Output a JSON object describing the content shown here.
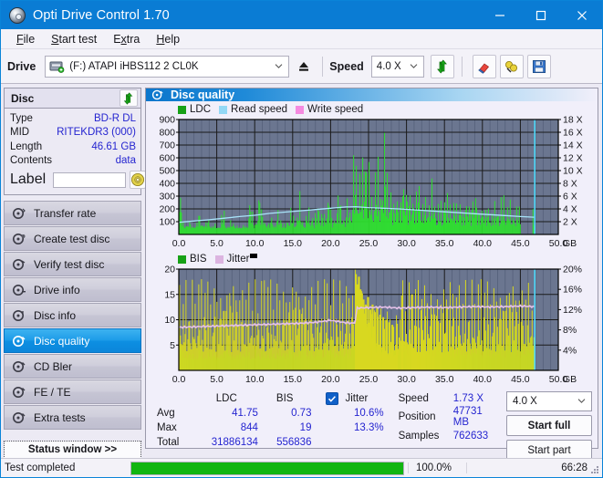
{
  "window": {
    "title": "Opti Drive Control 1.70",
    "icon": "disc-icon",
    "minimize": "minimize-icon",
    "maximize": "maximize-icon",
    "close": "close-icon"
  },
  "menu": [
    {
      "label": "File",
      "accel": "F"
    },
    {
      "label": "Start test",
      "accel": "S"
    },
    {
      "label": "Extra",
      "accel": "x"
    },
    {
      "label": "Help",
      "accel": "H"
    }
  ],
  "toolbar": {
    "drive_label": "Drive",
    "drive_value": "(F:)  ATAPI iHBS112  2 CL0K",
    "eject_icon": "eject-icon",
    "speed_label": "Speed",
    "speed_value": "4.0 X",
    "refresh_icon": "refresh-icon",
    "eraser_icon": "eraser-icon",
    "bulb_icon": "bulb-icon",
    "save_icon": "save-icon"
  },
  "disc_panel": {
    "title": "Disc",
    "refresh_icon": "refresh-icon",
    "rows": [
      {
        "key": "Type",
        "value": "BD-R DL"
      },
      {
        "key": "MID",
        "value": "RITEKDR3 (000)"
      },
      {
        "key": "Length",
        "value": "46.61 GB"
      },
      {
        "key": "Contents",
        "value": "data"
      }
    ],
    "label_key": "Label",
    "label_value": "",
    "label_placeholder": "",
    "cd_icon": "cd-icon"
  },
  "nav": {
    "items": [
      {
        "label": "Transfer rate",
        "icon": "disc-test-icon",
        "active": false
      },
      {
        "label": "Create test disc",
        "icon": "disc-test-icon",
        "active": false
      },
      {
        "label": "Verify test disc",
        "icon": "disc-test-icon",
        "active": false
      },
      {
        "label": "Drive info",
        "icon": "disc-test-icon",
        "active": false
      },
      {
        "label": "Disc info",
        "icon": "disc-test-icon",
        "active": false
      },
      {
        "label": "Disc quality",
        "icon": "disc-test-icon",
        "active": true
      },
      {
        "label": "CD Bler",
        "icon": "disc-test-icon",
        "active": false
      },
      {
        "label": "FE / TE",
        "icon": "disc-test-icon",
        "active": false
      },
      {
        "label": "Extra tests",
        "icon": "disc-test-icon",
        "active": false
      }
    ],
    "status_window": "Status window >>"
  },
  "content": {
    "header_title": "Disc quality",
    "header_icon": "disc-quality-icon"
  },
  "stats": {
    "headers": {
      "ldc": "LDC",
      "bis": "BIS"
    },
    "rows": [
      {
        "key": "Avg",
        "ldc": "41.75",
        "bis": "0.73"
      },
      {
        "key": "Max",
        "ldc": "844",
        "bis": "19"
      },
      {
        "key": "Total",
        "ldc": "31886134",
        "bis": "556836"
      }
    ],
    "jitter": {
      "label": "Jitter",
      "checked": true,
      "avg": "10.6%",
      "max": "13.3%"
    },
    "speed": {
      "key": "Speed",
      "value": "1.73 X"
    },
    "position": {
      "key": "Position",
      "value": "47731 MB"
    },
    "samples": {
      "key": "Samples",
      "value": "762633"
    },
    "speed_select": "4.0 X",
    "start_full": "Start full",
    "start_part": "Start part"
  },
  "statusbar": {
    "text": "Test completed",
    "percent_label": "100.0%",
    "percent_value": 100,
    "time": "66:28",
    "bar_color": "#11b511"
  },
  "chart_data": [
    {
      "type": "area",
      "name": "ldc-chart",
      "title": "",
      "xlabel": "GB",
      "ylabel": "",
      "xlim": [
        0,
        50
      ],
      "ylim": [
        0,
        900
      ],
      "xticks": [
        "0.0",
        "5.0",
        "10.0",
        "15.0",
        "20.0",
        "25.0",
        "30.0",
        "35.0",
        "40.0",
        "45.0",
        "50.0"
      ],
      "yticks": [
        100,
        200,
        300,
        400,
        500,
        600,
        700,
        800,
        900
      ],
      "y2ticks": [
        "2 X",
        "4 X",
        "6 X",
        "8 X",
        "10 X",
        "12 X",
        "14 X",
        "16 X",
        "18 X"
      ],
      "y2lim": [
        0,
        18
      ],
      "x_unit_label": "GB",
      "grid": true,
      "plot_bg": "#6b7690",
      "legend_position": "top-left",
      "legend": [
        {
          "name": "LDC",
          "color": "#17a117"
        },
        {
          "name": "Read speed",
          "color": "#93d8f5"
        },
        {
          "name": "Write speed",
          "color": "#f58ae0"
        }
      ],
      "series": [
        {
          "name": "LDC",
          "kind": "spikes",
          "color": "#2ee02e",
          "x": [
            0.2,
            0.6,
            1.0,
            1.4,
            1.8,
            2.2,
            2.6,
            3.0,
            3.4,
            3.8,
            4.2,
            4.6,
            5.0,
            5.4,
            5.8,
            6.2,
            6.6,
            7.0,
            7.4,
            7.8,
            8.2,
            8.6,
            9.0,
            9.4,
            9.8,
            10.2,
            10.6,
            11.0,
            11.4,
            11.8,
            12.2,
            12.6,
            13.0,
            13.4,
            13.8,
            14.2,
            14.6,
            15.0,
            15.4,
            15.8,
            16.2,
            16.6,
            17.0,
            17.4,
            17.8,
            18.2,
            18.6,
            19.0,
            19.4,
            19.8,
            20.2,
            20.6,
            21.0,
            21.4,
            21.8,
            22.2,
            22.6,
            23.0,
            23.4,
            23.8,
            24.2,
            24.6,
            25.0,
            25.4,
            25.8,
            26.2,
            26.6,
            27.0,
            27.4,
            27.8,
            28.2,
            28.6,
            29.0,
            29.4,
            29.8,
            30.2,
            30.6,
            31.0,
            31.4,
            31.8,
            32.2,
            32.6,
            33.0,
            33.4,
            33.8,
            34.2,
            34.6,
            35.0,
            35.4,
            35.8,
            36.2,
            36.6,
            37.0,
            37.4,
            37.8,
            38.2,
            38.6,
            39.0,
            39.4,
            39.8,
            40.2,
            40.6,
            41.0,
            41.4,
            41.8,
            42.2,
            42.6,
            43.0,
            43.4,
            43.8,
            44.2,
            44.6,
            45.0,
            45.4,
            45.8,
            46.2,
            46.6
          ],
          "y": [
            310,
            60,
            70,
            95,
            55,
            60,
            200,
            65,
            90,
            120,
            60,
            80,
            55,
            65,
            210,
            60,
            70,
            125,
            60,
            55,
            60,
            70,
            60,
            300,
            70,
            90,
            320,
            180,
            70,
            95,
            130,
            60,
            170,
            110,
            70,
            80,
            250,
            130,
            90,
            330,
            120,
            70,
            240,
            160,
            70,
            290,
            110,
            190,
            150,
            340,
            95,
            120,
            400,
            140,
            110,
            270,
            130,
            690,
            430,
            560,
            500,
            850,
            480,
            320,
            420,
            510,
            380,
            700,
            560,
            320,
            260,
            290,
            240,
            390,
            310,
            300,
            250,
            270,
            420,
            300,
            240,
            260,
            300,
            390,
            220,
            200,
            230,
            370,
            250,
            300,
            210,
            270,
            230,
            180,
            250,
            200,
            230,
            310,
            200,
            180,
            220,
            190,
            170,
            200,
            250,
            180,
            300,
            220,
            270,
            190,
            160,
            200,
            280
          ]
        },
        {
          "name": "Read speed",
          "kind": "line",
          "color": "#a8e4fa",
          "x": [
            0,
            2,
            4,
            6,
            8,
            10,
            12,
            14,
            16,
            18,
            20,
            22,
            23.3,
            25,
            27,
            29,
            31,
            33,
            35,
            37,
            39,
            41,
            43,
            45,
            46.8
          ],
          "y_speed_x": [
            1.9,
            2.1,
            2.3,
            2.55,
            2.8,
            3.0,
            3.3,
            3.5,
            3.7,
            3.9,
            4.1,
            4.3,
            4.35,
            4.2,
            4.1,
            4.0,
            3.85,
            3.7,
            3.55,
            3.4,
            3.25,
            3.1,
            2.95,
            2.8,
            2.7
          ]
        },
        {
          "name": "Write speed",
          "kind": "none",
          "color": "#f58ae0",
          "x": [],
          "y": []
        }
      ],
      "marker_line": {
        "x": 46.9,
        "color": "#4fd8f8"
      }
    },
    {
      "type": "area",
      "name": "bis-jitter-chart",
      "title": "",
      "xlabel": "GB",
      "ylabel": "",
      "xlim": [
        0,
        50
      ],
      "ylim": [
        0,
        20
      ],
      "xticks": [
        "0.0",
        "5.0",
        "10.0",
        "15.0",
        "20.0",
        "25.0",
        "30.0",
        "35.0",
        "40.0",
        "45.0",
        "50.0"
      ],
      "yticks": [
        5,
        10,
        15,
        20
      ],
      "y2ticks": [
        "4%",
        "8%",
        "12%",
        "16%",
        "20%"
      ],
      "y2lim": [
        0,
        20
      ],
      "x_unit_label": "GB",
      "grid": true,
      "plot_bg": "#6b7690",
      "legend_position": "top-left",
      "legend": [
        {
          "name": "BIS",
          "color": "#17a117"
        },
        {
          "name": "Jitter",
          "color": "#dcb4e0"
        }
      ],
      "series": [
        {
          "name": "BIS",
          "kind": "spikes",
          "color": "#2ee02e",
          "x": [
            0.3,
            0.8,
            1.3,
            1.8,
            2.3,
            2.8,
            3.3,
            3.8,
            4.3,
            4.8,
            5.3,
            5.8,
            6.3,
            6.8,
            7.3,
            7.8,
            8.3,
            8.8,
            9.3,
            9.8,
            10.3,
            10.8,
            11.3,
            11.8,
            12.3,
            12.8,
            13.3,
            13.8,
            14.3,
            14.8,
            15.3,
            15.8,
            16.3,
            16.8,
            17.3,
            17.8,
            18.3,
            18.8,
            19.3,
            19.8,
            20.3,
            20.8,
            21.3,
            21.8,
            22.3,
            22.8,
            23.3,
            23.8,
            24.3,
            24.8,
            25.3,
            25.8,
            26.3,
            26.8,
            27.3,
            27.8,
            28.3,
            28.8,
            29.3,
            29.8,
            30.3,
            30.8,
            31.3,
            31.8,
            32.3,
            32.8,
            33.3,
            33.8,
            34.3,
            34.8,
            35.3,
            35.8,
            36.3,
            36.8,
            37.3,
            37.8,
            38.3,
            38.8,
            39.3,
            39.8,
            40.3,
            40.8,
            41.3,
            41.8,
            42.3,
            42.8,
            43.3,
            43.8,
            44.3,
            44.8,
            45.3,
            45.8,
            46.3,
            46.8
          ],
          "y": [
            5,
            3,
            4,
            2.5,
            3,
            4,
            2.5,
            3,
            4.5,
            2.5,
            3,
            4,
            5,
            3,
            2.5,
            4,
            3,
            5,
            2.5,
            3,
            4,
            3,
            5,
            3,
            4,
            2.5,
            5,
            3,
            4,
            6,
            3,
            4,
            7,
            3,
            5,
            4,
            8,
            5,
            4,
            9,
            5,
            4,
            6,
            5,
            4,
            6,
            19,
            12,
            11,
            13,
            10,
            9,
            12,
            8,
            10,
            7,
            9,
            6,
            7,
            8,
            5,
            15,
            7,
            6,
            8,
            5,
            7,
            6,
            8,
            5,
            7,
            6,
            5,
            8,
            6,
            5,
            7,
            6,
            9,
            5,
            6,
            7,
            5,
            8,
            6,
            5,
            7,
            6,
            9,
            5,
            7,
            6,
            8,
            9
          ]
        },
        {
          "name": "Jitter",
          "kind": "line",
          "color": "#e2bfe6",
          "x": [
            0,
            2,
            4,
            6,
            8,
            10,
            12,
            14,
            16,
            18,
            20,
            22,
            23.2,
            23.5,
            25,
            27,
            29,
            31,
            33,
            35,
            37,
            39,
            41,
            43,
            45,
            46.8
          ],
          "y_pct": [
            8.5,
            8.6,
            8.7,
            8.8,
            8.9,
            9.0,
            9.1,
            9.2,
            9.3,
            9.5,
            9.9,
            9.4,
            9.3,
            12.3,
            12.4,
            12.5,
            12.3,
            12.4,
            12.5,
            12.4,
            12.5,
            12.6,
            12.5,
            12.6,
            12.7,
            12.6
          ]
        },
        {
          "name": "Jitter spikes",
          "kind": "spikes",
          "color": "#d8d820",
          "x": [
            23.2,
            23.4,
            23.6,
            23.8,
            24.0,
            24.2,
            24.5,
            24.8,
            25.1,
            25.4,
            25.7,
            26.0,
            26.4,
            26.8,
            27.2,
            27.6,
            28.0,
            28.6,
            29.3,
            30.6
          ],
          "y": [
            19,
            17,
            18.5,
            16,
            15.2,
            14,
            13,
            14.5,
            12,
            13,
            11.5,
            12.5,
            11,
            10.5,
            10,
            9.5,
            9,
            9.2,
            14.8,
            15
          ]
        }
      ],
      "marker_line": {
        "x": 46.9,
        "color": "#4fd8f8"
      }
    }
  ]
}
